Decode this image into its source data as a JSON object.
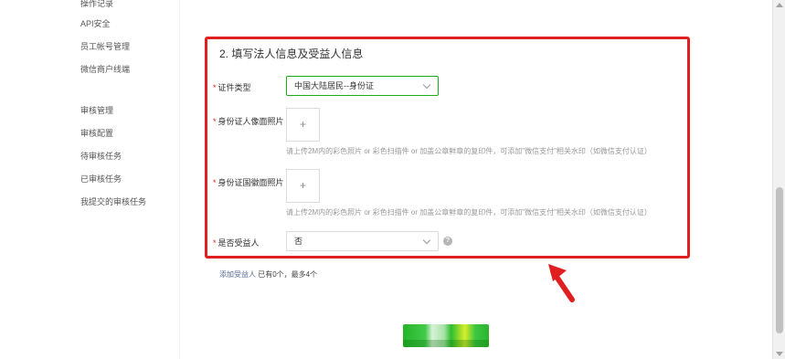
{
  "sidebar": {
    "items": [
      {
        "label": "操作记录"
      },
      {
        "label": "API安全"
      },
      {
        "label": "员工帐号管理"
      },
      {
        "label": "微信商户线端"
      },
      {
        "label": "审核管理"
      },
      {
        "label": "审核配置"
      },
      {
        "label": "待审核任务"
      },
      {
        "label": "已审核任务"
      },
      {
        "label": "我提交的审核任务"
      }
    ]
  },
  "form": {
    "section_title": "2. 填写法人信息及受益人信息",
    "required_mark": "*",
    "id_type": {
      "label": "证件类型",
      "value": "中国大陆居民--身份证"
    },
    "id_front": {
      "label": "身份证人像面照片",
      "plus": "+",
      "hint": "请上传2M内的彩色照片 or 彩色扫描件 or 加盖公章鲜章的复印件，可添加\"微信支付\"相关水印（如微信支付认证）"
    },
    "id_back": {
      "label": "身份证国徽面照片",
      "plus": "+",
      "hint": "请上传2M内的彩色照片 or 彩色扫描件 or 加盖公章鲜章的复印件，可添加\"微信支付\"相关水印（如微信支付认证）"
    },
    "beneficiary": {
      "label": "是否受益人",
      "value": "否",
      "help": "?"
    },
    "add_beneficiary": {
      "link": "添加受益人",
      "status": "已有0个，最多4个"
    }
  },
  "colors": {
    "accent": "#1aad19",
    "highlight": "#e02020",
    "link": "#576b95"
  },
  "icons": [
    "chevron-down-icon",
    "plus-icon",
    "question-icon",
    "red-arrow-icon"
  ]
}
